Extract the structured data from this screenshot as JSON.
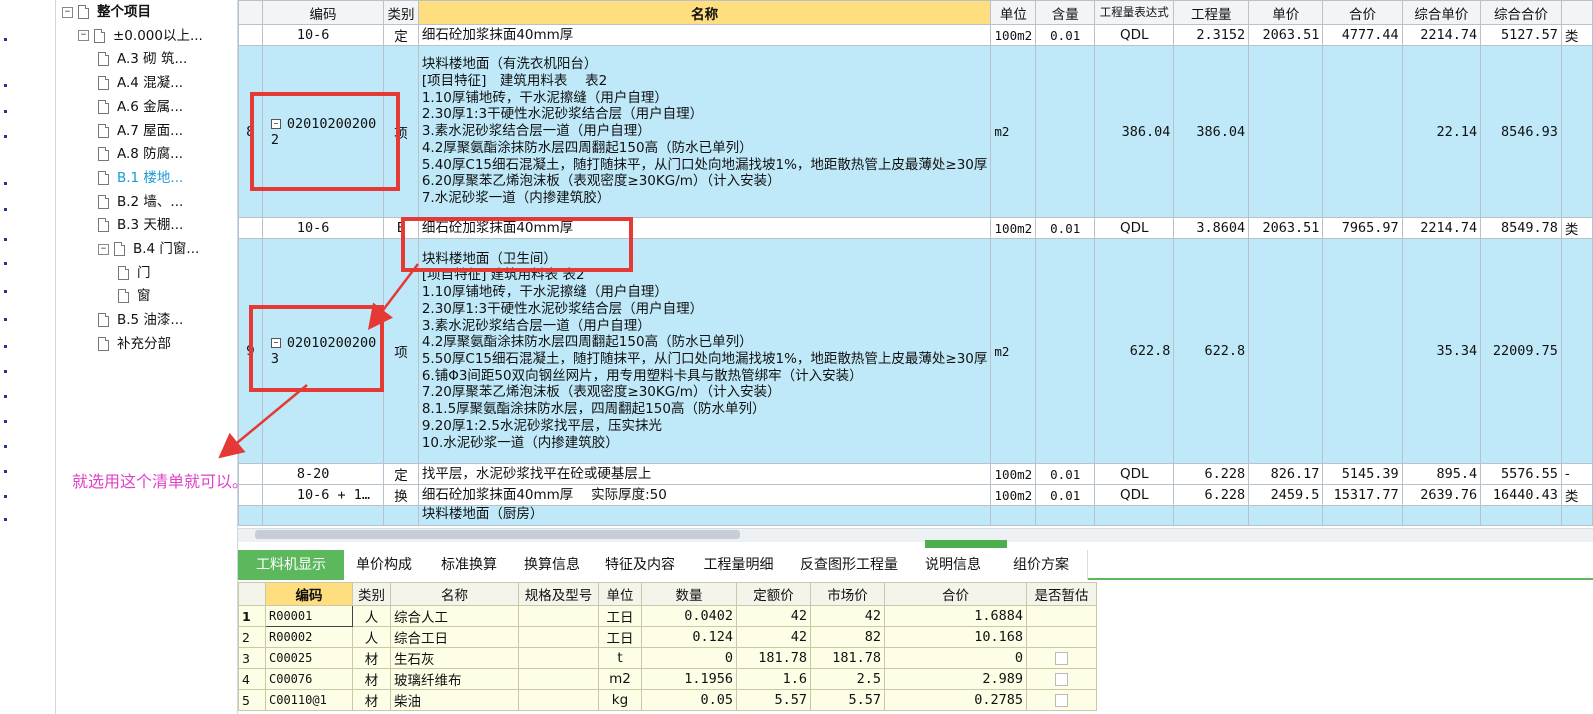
{
  "tree": {
    "collapse_icon": "«",
    "nodes": [
      {
        "label": "整个项目",
        "expander": "−"
      },
      {
        "label": "±0.000以上...",
        "expander": "−"
      },
      {
        "label": "A.3 砌 筑..."
      },
      {
        "label": "A.4 混凝..."
      },
      {
        "label": "A.6 金属..."
      },
      {
        "label": "A.7 屋面..."
      },
      {
        "label": "A.8 防腐..."
      },
      {
        "label": "B.1 楼地...",
        "selected": true
      },
      {
        "label": "B.2 墙、..."
      },
      {
        "label": "B.3 天棚..."
      },
      {
        "label": "B.4 门窗...",
        "expander": "−"
      },
      {
        "label": "门"
      },
      {
        "label": "窗"
      },
      {
        "label": "B.5 油漆..."
      },
      {
        "label": "补充分部"
      }
    ]
  },
  "grid": {
    "columns": [
      "编码",
      "类别",
      "名称",
      "单位",
      "含量",
      "工程量表达式",
      "工程量",
      "单价",
      "合价",
      "综合单价",
      "综合合价"
    ],
    "rows": [
      {
        "idx": "",
        "code": "10-6",
        "type": "定",
        "name": "细石砼加浆抹面40mm厚",
        "unit": "100m2",
        "qty_ratio": "0.01",
        "expr": "QDL",
        "qty": "2.3152",
        "price": "2063.51",
        "total": "4777.44",
        "cprice": "2214.74",
        "ctotal": "5127.57",
        "extra": "类"
      },
      {
        "idx": "8",
        "code": "020102002002",
        "type": "项",
        "name_lines": [
          "块料楼地面（有洗衣机阳台）",
          "[项目特征]　建筑用料表　 表2",
          "1.10厚铺地砖，干水泥擦缝（用户自理）",
          "2.30厚1:3干硬性水泥砂浆结合层（用户自理）",
          "3.素水泥砂浆结合层一道（用户自理）",
          "4.2厚聚氨酯涂抹防水层四周翻起150高（防水已单列）",
          "5.40厚C15细石混凝土，随打随抹平，从门口处向地漏找坡1%，地距散热管上皮最薄处≥30厚",
          "6.20厚聚苯乙烯泡沫板（表观密度≥30KG/m）（计入安装）",
          "7.水泥砂浆一道（内掺建筑胶）"
        ],
        "unit": "m2",
        "qty_ratio": "",
        "expr": "386.04",
        "qty": "386.04",
        "price": "",
        "total": "",
        "cprice": "22.14",
        "ctotal": "8546.93",
        "extra": ""
      },
      {
        "idx": "",
        "code": "10-6",
        "type": "E",
        "name": "细石砼加浆抹面40mm厚",
        "unit": "100m2",
        "qty_ratio": "0.01",
        "expr": "QDL",
        "qty": "3.8604",
        "price": "2063.51",
        "total": "7965.97",
        "cprice": "2214.74",
        "ctotal": "8549.78",
        "extra": "类"
      },
      {
        "idx": "9",
        "code": "020102002003",
        "type": "项",
        "name_lines": [
          "块料楼地面（卫生间）",
          "[项目特征] 建筑用料表 表2",
          "1.10厚铺地砖，干水泥擦缝（用户自理）",
          "2.30厚1:3干硬性水泥砂浆结合层（用户自理）",
          "3.素水泥砂浆结合层一道（用户自理）",
          "4.2厚聚氨酯涂抹防水层四周翻起150高（防水已单列）",
          "5.50厚C15细石混凝土，随打随抹平，从门口处向地漏找坡1%，地距散热管上皮最薄处≥30厚",
          "6.铺Φ3间距50双向钢丝网片，用专用塑料卡具与散热管绑牢（计入安装）",
          "7.20厚聚苯乙烯泡沫板（表观密度≥30KG/m）（计入安装）",
          "8.1.5厚聚氨酯涂抹防水层，四周翻起150高（防水单列）",
          "9.20厚1:2.5水泥砂浆找平层，压实抹光",
          "10.水泥砂浆一道（内掺建筑胶）"
        ],
        "unit": "m2",
        "qty_ratio": "",
        "expr": "622.8",
        "qty": "622.8",
        "price": "",
        "total": "",
        "cprice": "35.34",
        "ctotal": "22009.75",
        "extra": ""
      },
      {
        "idx": "",
        "code": "8-20",
        "type": "定",
        "name": "找平层，水泥砂浆找平在砼或硬基层上",
        "unit": "100m2",
        "qty_ratio": "0.01",
        "expr": "QDL",
        "qty": "6.228",
        "price": "826.17",
        "total": "5145.39",
        "cprice": "895.4",
        "ctotal": "5576.55",
        "extra": "-"
      },
      {
        "idx": "",
        "code": "10-6 + 1…",
        "type": "换",
        "name": "细石砼加浆抹面40mm厚　 实际厚度:50",
        "unit": "100m2",
        "qty_ratio": "0.01",
        "expr": "QDL",
        "qty": "6.228",
        "price": "2459.5",
        "total": "15317.77",
        "cprice": "2639.76",
        "ctotal": "16440.43",
        "extra": "类"
      },
      {
        "idx": "",
        "code": "",
        "type": "",
        "name": "块料楼地面（厨房）",
        "unit": "",
        "qty_ratio": "",
        "expr": "",
        "qty": "",
        "price": "",
        "total": "",
        "cprice": "",
        "ctotal": "",
        "extra": ""
      }
    ]
  },
  "tabs": [
    "工料机显示",
    "单价构成",
    "标准换算",
    "换算信息",
    "特征及内容",
    "工程量明细",
    "反查图形工程量",
    "说明信息",
    "组价方案"
  ],
  "bottom": {
    "columns": [
      "编码",
      "类别",
      "名称",
      "规格及型号",
      "单位",
      "数量",
      "定额价",
      "市场价",
      "合价",
      "是否暂估"
    ],
    "rows": [
      {
        "idx": "1",
        "code": "R00001",
        "type": "人",
        "name": "综合人工",
        "spec": "",
        "unit": "工日",
        "qty": "0.0402",
        "quota": "42",
        "market": "42",
        "total": "1.6884",
        "temp": false
      },
      {
        "idx": "2",
        "code": "R00002",
        "type": "人",
        "name": "综合工日",
        "spec": "",
        "unit": "工日",
        "qty": "0.124",
        "quota": "42",
        "market": "82",
        "total": "10.168",
        "temp": false
      },
      {
        "idx": "3",
        "code": "C00025",
        "type": "材",
        "name": "生石灰",
        "spec": "",
        "unit": "t",
        "qty": "0",
        "quota": "181.78",
        "market": "181.78",
        "total": "0",
        "temp": true
      },
      {
        "idx": "4",
        "code": "C00076",
        "type": "材",
        "name": "玻璃纤维布",
        "spec": "",
        "unit": "m2",
        "qty": "1.1956",
        "quota": "1.6",
        "market": "2.5",
        "total": "2.989",
        "temp": true
      },
      {
        "idx": "5",
        "code": "C00110@1",
        "type": "材",
        "name": "柴油",
        "spec": "",
        "unit": "kg",
        "qty": "0.05",
        "quota": "5.57",
        "market": "5.57",
        "total": "0.2785",
        "temp": true
      }
    ]
  },
  "annotation": {
    "text": "就选用这个清单就可以。",
    "color": "#e040c8",
    "box_color": "#e53935"
  }
}
